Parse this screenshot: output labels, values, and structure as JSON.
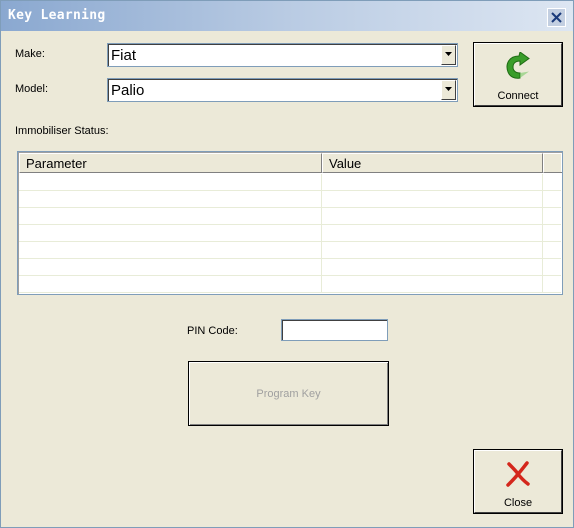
{
  "window": {
    "title": "Key Learning"
  },
  "form": {
    "make_label": "Make:",
    "make_value": "Fiat",
    "model_label": "Model:",
    "model_value": "Palio",
    "status_label": "Immobiliser Status:"
  },
  "table": {
    "columns": [
      "Parameter",
      "Value"
    ],
    "rows": [
      [
        "",
        ""
      ],
      [
        "",
        ""
      ],
      [
        "",
        ""
      ],
      [
        "",
        ""
      ],
      [
        "",
        ""
      ],
      [
        "",
        ""
      ],
      [
        "",
        ""
      ]
    ]
  },
  "pin": {
    "label": "PIN Code:",
    "value": ""
  },
  "buttons": {
    "connect_label": "Connect",
    "program_key_label": "Program Key",
    "close_label": "Close"
  },
  "icons": {
    "connect": "green-arrow-icon",
    "close": "red-x-icon",
    "title_close": "close-icon",
    "combo_arrow": "chevron-down-icon"
  },
  "colors": {
    "connect_icon": "#3a9d2a",
    "close_icon": "#d4271c",
    "disabled_text": "#a0a0a0",
    "window_bg": "#ece9d8"
  }
}
